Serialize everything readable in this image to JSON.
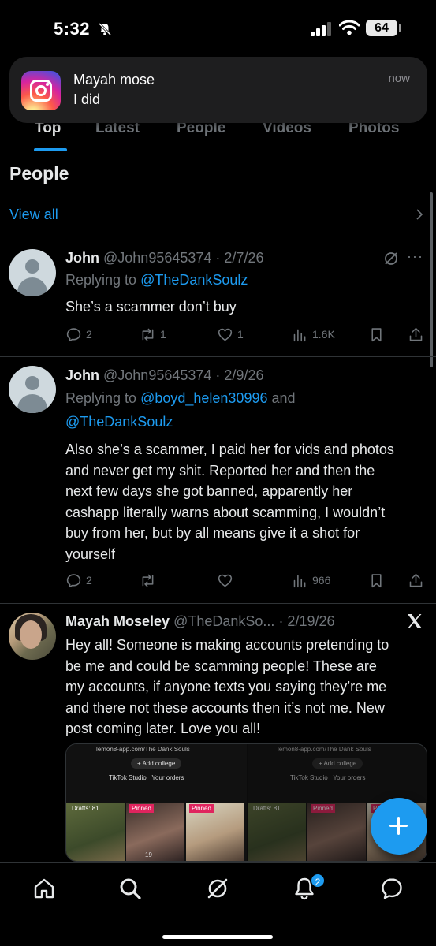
{
  "status_bar": {
    "time": "5:32",
    "battery": "64"
  },
  "notification": {
    "sender": "Mayah mose",
    "message": "I did",
    "time": "now",
    "app_icon": "instagram-icon"
  },
  "tabs": [
    {
      "label": "Top",
      "active": true
    },
    {
      "label": "Latest",
      "active": false
    },
    {
      "label": "People",
      "active": false
    },
    {
      "label": "Videos",
      "active": false
    },
    {
      "label": "Photos",
      "active": false
    }
  ],
  "section": {
    "title": "People",
    "view_all": "View all"
  },
  "tweets": [
    {
      "name": "John",
      "handle": "@John95645374",
      "date": "· 2/7/26",
      "reply_prefix": "Replying to ",
      "reply_to": "@TheDankSoulz",
      "text": "She’s a scammer don’t buy",
      "replies": "2",
      "reposts": "1",
      "likes": "1",
      "views": "1.6K"
    },
    {
      "name": "John",
      "handle": "@John95645374",
      "date": "· 2/9/26",
      "reply_prefix": "Replying to ",
      "reply_to_1": "@boyd_helen30996",
      "reply_and": " and",
      "reply_to_2": "@TheDankSoulz",
      "text": "Also she’s a scammer, I paid her for vids and photos and never get my shit. Reported her and then the next few days she got banned, apparently her cashapp literally warns about scamming, I wouldn’t buy from her, but by all means give it a shot for yourself",
      "replies": "2",
      "reposts": "",
      "likes": "",
      "views": "966"
    },
    {
      "name": "Mayah Moseley",
      "handle": "@TheDankSo...",
      "date": "· 2/19/26",
      "text": "Hey all! Someone is making accounts pretending to be me and could be scamming people! These are my accounts, if anyone texts you saying they’re me and there not these accounts then it’s not me. New post coming later. Love you all!",
      "media": {
        "left": {
          "url": "lemon8-app.com/The Dank Souls",
          "add": "+ Add college",
          "link1": "TikTok Studio",
          "link2": "Your orders",
          "drafts": "Drafts: 81",
          "pinned1": "Pinned",
          "pinned2": "Pinned",
          "bottom": "19"
        },
        "right": {
          "url": "lemon8-app.com/The Dank Souls",
          "add": "+ Add college",
          "link1": "TikTok Studio",
          "link2": "Your orders",
          "drafts": "Drafts: 81",
          "pinned1": "Pinned",
          "pinned2": "Pinned"
        }
      }
    }
  ],
  "bottom_nav": {
    "notifications_badge": "2"
  }
}
